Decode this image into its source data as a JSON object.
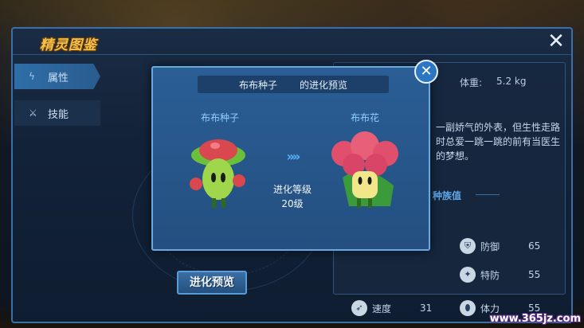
{
  "panel": {
    "title": "精灵图鉴",
    "close_icon": "close-icon"
  },
  "tabs": [
    {
      "label": "属性",
      "icon": "lightning-icon",
      "active": true
    },
    {
      "label": "技能",
      "icon": "sword-icon",
      "active": false
    }
  ],
  "evolve_button": "进化预览",
  "info": {
    "weight_label": "体重:",
    "weight_value": "5.2  kg",
    "description": "一副娇气的外表，但生性走路时总爱一跳一跳的前有当医生的梦想。",
    "race_title": "种族值",
    "stats": [
      {
        "name": "防御",
        "value": "65",
        "icon": "shield-icon"
      },
      {
        "name": "特防",
        "value": "55",
        "icon": "special-shield-icon"
      },
      {
        "name": "速度",
        "value": "31",
        "icon": "wing-icon"
      },
      {
        "name": "体力",
        "value": "55",
        "icon": "potion-icon"
      }
    ]
  },
  "modal": {
    "header_pet": "布布种子",
    "header_suffix": "的进化预览",
    "left_pet": "布布种子",
    "right_pet": "布布花",
    "arrows": "»»",
    "condition_line1": "进化等级",
    "condition_line2": "20级"
  },
  "watermark": "www.365jz.com",
  "colors": {
    "accent_gold": "#f3c24a",
    "panel_border": "#3e6ea6",
    "modal_bg": "#2a5e95",
    "name_cyan": "#8fd0ff"
  }
}
